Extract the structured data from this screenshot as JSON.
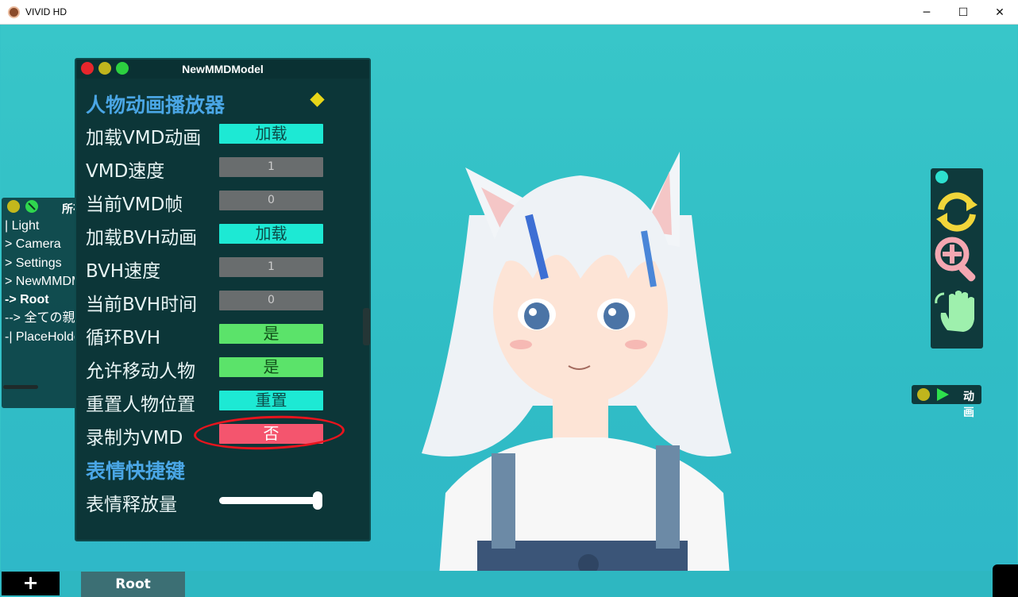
{
  "window": {
    "title": "VIVID HD",
    "minimize": "─",
    "maximize": "☐",
    "close": "✕"
  },
  "hierarchy": {
    "title": "所有物体",
    "items": [
      {
        "label": "| Light"
      },
      {
        "label": "> Camera"
      },
      {
        "label": "> Settings"
      },
      {
        "label": "> NewMMDModel"
      },
      {
        "label": "-> Root"
      },
      {
        "label": "--> 全ての親"
      },
      {
        "label": "-| PlaceHolder"
      }
    ]
  },
  "model_panel": {
    "title": "NewMMDModel",
    "section_player": "人物动画播放器",
    "rows": [
      {
        "label": "加载VMD动画",
        "value": "加载"
      },
      {
        "label": "VMD速度",
        "value": "1"
      },
      {
        "label": "当前VMD帧",
        "value": "0"
      },
      {
        "label": "加载BVH动画",
        "value": "加载"
      },
      {
        "label": "BVH速度",
        "value": "1"
      },
      {
        "label": "当前BVH时间",
        "value": "0"
      },
      {
        "label": "循环BVH",
        "value": "是"
      },
      {
        "label": "允许移动人物",
        "value": "是"
      },
      {
        "label": "重置人物位置",
        "value": "重置"
      },
      {
        "label": "录制为VMD",
        "value": "否"
      }
    ],
    "section_expression": "表情快捷键",
    "expression_label": "表情释放量",
    "expression_level": 1.0
  },
  "tools": {
    "icons": [
      "rotate-icon",
      "zoom-in-icon",
      "pan-hand-icon"
    ]
  },
  "animation": {
    "label": "动画"
  },
  "bottombar": {
    "add_label": "+",
    "root_tab": "Root"
  },
  "colors": {
    "background": "#35c3c8",
    "panel": "#0c3638",
    "accent_cyan": "#1de9d4",
    "accent_green": "#5be36a",
    "accent_red": "#f4556e",
    "section_blue": "#4aa6e5",
    "annotation_red": "#e8141d"
  }
}
